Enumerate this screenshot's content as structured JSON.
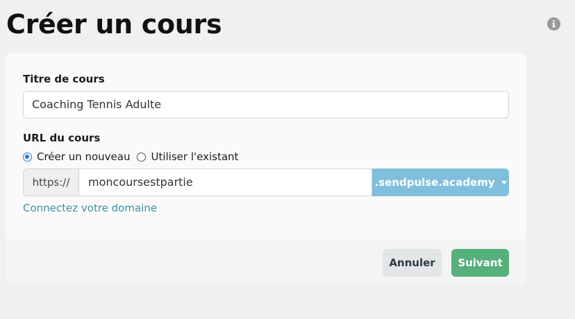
{
  "page": {
    "title": "Créer un cours"
  },
  "form": {
    "course_title_label": "Titre de cours",
    "course_title_value": "Coaching Tennis Adulte",
    "url_label": "URL du cours",
    "radio_options": [
      {
        "label": "Créer un nouveau",
        "checked": true
      },
      {
        "label": "Utiliser l'existant",
        "checked": false
      }
    ],
    "url_prefix": "https://",
    "url_value": "moncoursestpartie",
    "url_domain": ".sendpulse.academy",
    "connect_domain_link": "Connectez votre domaine"
  },
  "footer": {
    "cancel_label": "Annuler",
    "next_label": "Suivant"
  },
  "icons": {
    "info": "info-icon",
    "dropdown": "chevron-down-icon"
  },
  "colors": {
    "accent_blue": "#7fbfdc",
    "link": "#3d8fa6",
    "primary_green": "#55b07b",
    "radio_checked": "#2f6fd6"
  }
}
